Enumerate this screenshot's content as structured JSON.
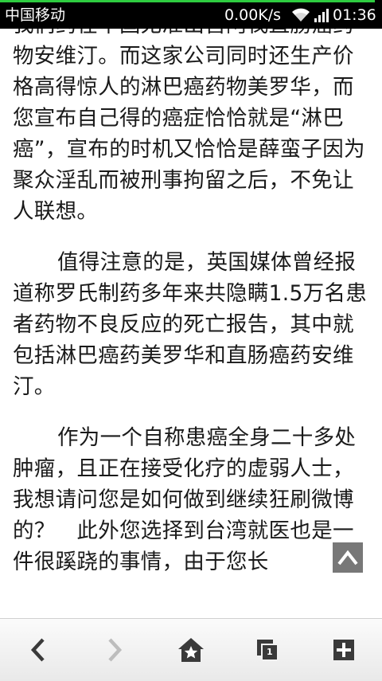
{
  "status_bar": {
    "carrier": "中国移动",
    "speed": "0.00K/s",
    "time": "01:36"
  },
  "article": {
    "paragraphs": [
      "我们药在中国尤准出售阿伐直肠癌药物安维汀。而这家公司同时还生产价格高得惊人的淋巴癌药物美罗华，而您宣布自己得的癌症恰恰就是“淋巴癌”，宣布的时机又恰恰是薛蛮子因为聚众淫乱而被刑事拘留之后，不免让人联想。",
      "值得注意的是，英国媒体曾经报道称罗氏制药多年来共隐瞒1.5万名患者药物不良反应的死亡报告，其中就包括淋巴癌药美罗华和直肠癌药安维汀。",
      "作为一个自称患癌全身二十多处肿瘤，且正在接受化疗的虚弱人士，我想请问您是如何做到继续狂刷微博的？　此外您选择到台湾就医也是一件很蹊跷的事情，由于您长"
    ]
  },
  "toolbar": {
    "tab_count": "1"
  },
  "icons": {
    "back": "chevron-left-icon",
    "forward": "chevron-right-icon",
    "home": "home-star-icon",
    "tabs": "tabs-icon",
    "new_tab": "plus-icon",
    "scroll_top": "chevron-up-icon"
  }
}
